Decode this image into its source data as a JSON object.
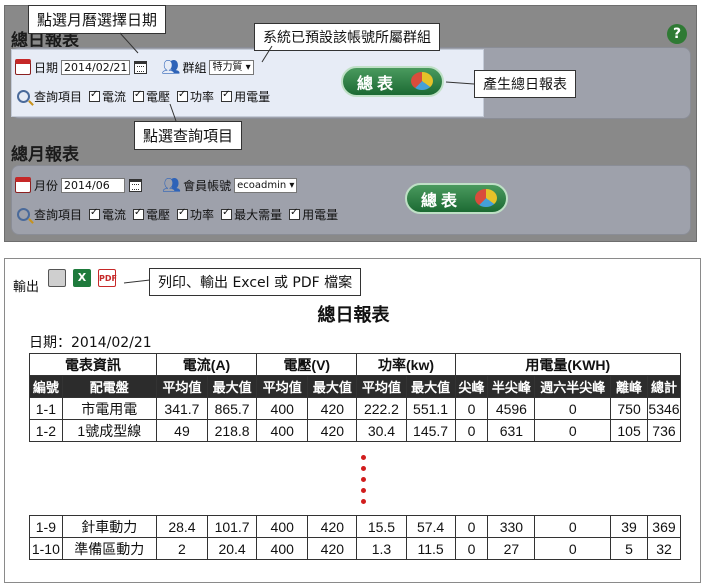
{
  "top": {
    "daily": {
      "title_partial": "總日報表",
      "date_label": "日期",
      "date_value": "2014/02/21",
      "group_label": "群組",
      "group_value": "特力質",
      "query_label": "查詢項目",
      "checks": [
        "電流",
        "電壓",
        "功率",
        "用電量"
      ],
      "button_label": "總表"
    },
    "monthly": {
      "title": "總月報表",
      "month_label": "月份",
      "month_value": "2014/06",
      "account_label": "會員帳號",
      "account_value": "ecoadmin",
      "query_label": "查詢項目",
      "checks": [
        "電流",
        "電壓",
        "功率",
        "最大需量",
        "用電量"
      ],
      "button_label": "總表"
    },
    "help_label": "?"
  },
  "callouts": {
    "calendar": "點選月曆選擇日期",
    "group": "系統已預設該帳號所屬群組",
    "generate": "產生總日報表",
    "query": "點選查詢項目",
    "export": "列印、輸出 Excel 或 PDF 檔案"
  },
  "report": {
    "export_label": "輸出",
    "title": "總日報表",
    "date_line": "日期：2014/02/21",
    "group_headers": [
      "電表資訊",
      "電流(A)",
      "電壓(V)",
      "功率(kw)",
      "用電量(KWH)"
    ],
    "columns": [
      "編號",
      "配電盤",
      "平均值",
      "最大值",
      "平均值",
      "最大值",
      "平均值",
      "最大值",
      "尖峰",
      "半尖峰",
      "週六半尖峰",
      "離峰",
      "總計"
    ],
    "rows_top": [
      [
        "1-1",
        "市電用電",
        "341.7",
        "865.7",
        "400",
        "420",
        "222.2",
        "551.1",
        "0",
        "4596",
        "0",
        "750",
        "5346"
      ],
      [
        "1-2",
        "1號成型線",
        "49",
        "218.8",
        "400",
        "420",
        "30.4",
        "145.7",
        "0",
        "631",
        "0",
        "105",
        "736"
      ]
    ],
    "rows_bottom": [
      [
        "1-9",
        "針車動力",
        "28.4",
        "101.7",
        "400",
        "420",
        "15.5",
        "57.4",
        "0",
        "330",
        "0",
        "39",
        "369"
      ],
      [
        "1-10",
        "準備區動力",
        "2",
        "20.4",
        "400",
        "420",
        "1.3",
        "11.5",
        "0",
        "27",
        "0",
        "5",
        "32"
      ]
    ]
  },
  "colors": {
    "header_bg": "#2c2c2c",
    "button_green": "#1c6a33",
    "dots": "#d11d1d"
  }
}
